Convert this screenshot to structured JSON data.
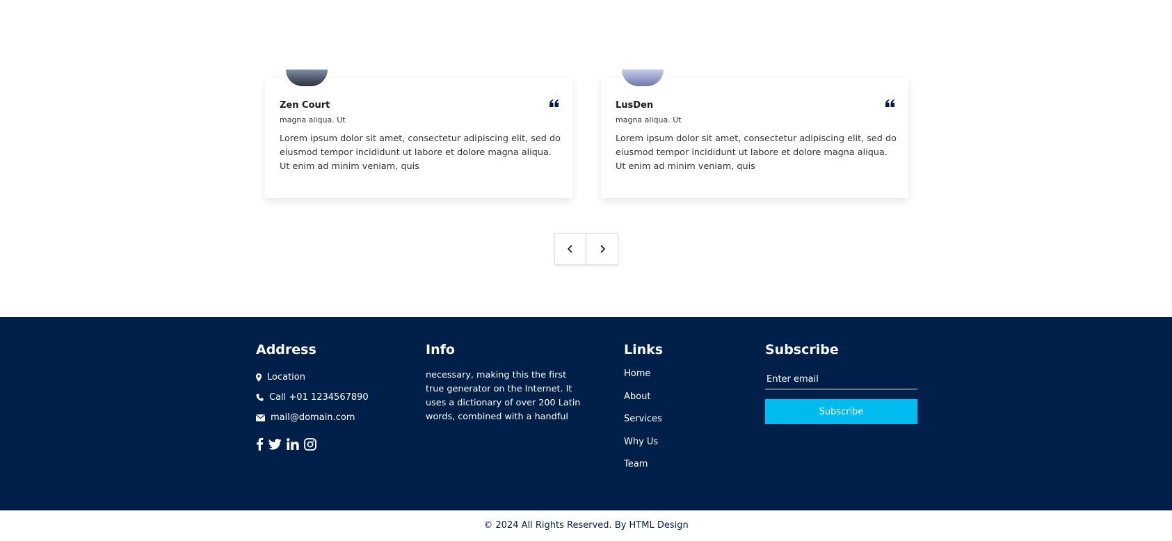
{
  "testimonials": [
    {
      "name": "Zen Court",
      "subtitle": "magna aliqua. Ut",
      "text": "Lorem ipsum dolor sit amet, consectetur adipiscing elit, sed do eiusmod tempor incididunt ut labore et dolore magna aliqua. Ut enim ad minim veniam, quis"
    },
    {
      "name": "LusDen",
      "subtitle": "magna aliqua. Ut",
      "text": "Lorem ipsum dolor sit amet, consectetur adipiscing elit, sed do eiusmod tempor incididunt ut labore et dolore magna aliqua. Ut enim ad minim veniam, quis"
    }
  ],
  "icons": {
    "quote": "quote-icon",
    "prev": "chevron-left-icon",
    "next": "chevron-right-icon",
    "location": "map-marker-icon",
    "phone": "phone-icon",
    "email": "envelope-icon",
    "social": [
      "facebook-icon",
      "twitter-icon",
      "linkedin-icon",
      "instagram-icon"
    ]
  },
  "footer": {
    "address": {
      "heading": "Address",
      "location": "Location",
      "phone": "Call +01 1234567890",
      "email": "mail@domain.com"
    },
    "info": {
      "heading": "Info",
      "text": "necessary, making this the first true generator on the Internet. It uses a dictionary of over 200 Latin words, combined with a handful"
    },
    "links": {
      "heading": "Links",
      "items": [
        "Home",
        "About",
        "Services",
        "Why Us",
        "Team"
      ]
    },
    "subscribe": {
      "heading": "Subscribe",
      "placeholder": "Enter email",
      "button": "Subscribe"
    }
  },
  "copyright": "© 2024 All Rights Reserved. By HTML Design",
  "colors": {
    "footer_bg": "#00204a",
    "accent": "#00bbf0",
    "text_dark": "#1d1d1d"
  }
}
